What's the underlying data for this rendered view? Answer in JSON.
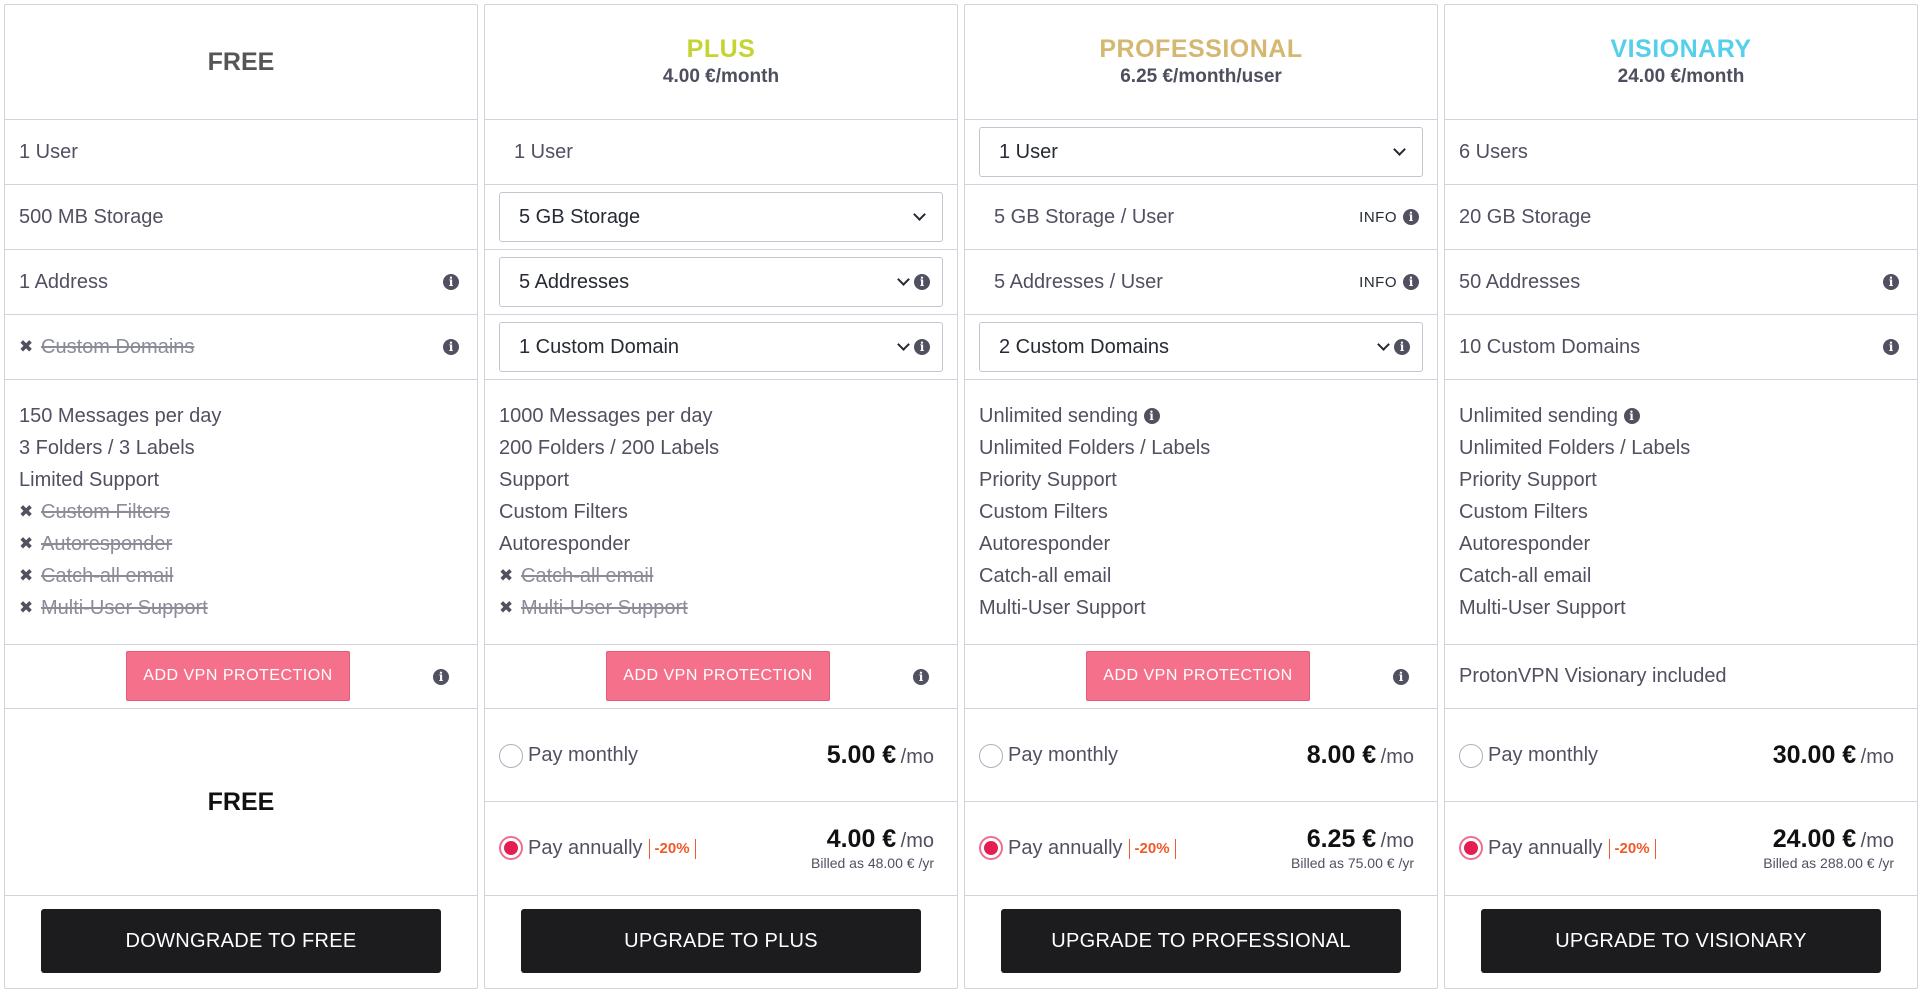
{
  "colors": {
    "plus": "#c5d433",
    "professional": "#d4b770",
    "visionary": "#55cfea",
    "vpn_button": "#f5708b",
    "cta_button": "#1c1c1f",
    "discount": "#f05a28",
    "radio_selected": "#e41e53"
  },
  "icons": {
    "info": "info-circle-icon",
    "unavailable": "x-icon",
    "dropdown": "chevron-down-icon"
  },
  "info_label": "INFO",
  "plans": {
    "free": {
      "name": "FREE",
      "users": "1 User",
      "storage": "500 MB Storage",
      "addresses": "1 Address",
      "domains": "Custom Domains",
      "features": [
        "150 Messages per day",
        "3 Folders / 3 Labels",
        "Limited Support",
        "Custom Filters",
        "Autoresponder",
        "Catch-all email",
        "Multi-User Support"
      ],
      "vpn_button": "ADD VPN PROTECTION",
      "price": "FREE",
      "cta": "DOWNGRADE TO FREE"
    },
    "plus": {
      "name": "PLUS",
      "price_line": "4.00 €/month",
      "users": "1 User",
      "storage": "5 GB Storage",
      "addresses": "5 Addresses",
      "domains": "1 Custom Domain",
      "features": [
        "1000 Messages per day",
        "200 Folders / 200 Labels",
        "Support",
        "Custom Filters",
        "Autoresponder",
        "Catch-all email",
        "Multi-User Support"
      ],
      "vpn_button": "ADD VPN PROTECTION",
      "monthly_label": "Pay monthly",
      "monthly_price": "5.00 €",
      "annual_label": "Pay annually",
      "discount": "-20%",
      "annual_price": "4.00 €",
      "per_month": "/mo",
      "billed": "Billed as 48.00 € /yr",
      "cta": "UPGRADE TO PLUS"
    },
    "professional": {
      "name": "PROFESSIONAL",
      "price_line": "6.25 €/month/user",
      "users": "1 User",
      "storage": "5 GB Storage / User",
      "addresses": "5 Addresses / User",
      "domains": "2 Custom Domains",
      "features": [
        "Unlimited sending",
        "Unlimited Folders / Labels",
        "Priority Support",
        "Custom Filters",
        "Autoresponder",
        "Catch-all email",
        "Multi-User Support"
      ],
      "vpn_button": "ADD VPN PROTECTION",
      "monthly_label": "Pay monthly",
      "monthly_price": "8.00 €",
      "annual_label": "Pay annually",
      "discount": "-20%",
      "annual_price": "6.25 €",
      "per_month": "/mo",
      "billed": "Billed as 75.00 € /yr",
      "cta": "UPGRADE TO PROFESSIONAL"
    },
    "visionary": {
      "name": "VISIONARY",
      "price_line": "24.00 €/month",
      "users": "6 Users",
      "storage": "20 GB Storage",
      "addresses": "50 Addresses",
      "domains": "10 Custom Domains",
      "features": [
        "Unlimited sending",
        "Unlimited Folders / Labels",
        "Priority Support",
        "Custom Filters",
        "Autoresponder",
        "Catch-all email",
        "Multi-User Support"
      ],
      "vpn_text": "ProtonVPN Visionary included",
      "monthly_label": "Pay monthly",
      "monthly_price": "30.00 €",
      "annual_label": "Pay annually",
      "discount": "-20%",
      "annual_price": "24.00 €",
      "per_month": "/mo",
      "billed": "Billed as 288.00 € /yr",
      "cta": "UPGRADE TO VISIONARY"
    }
  }
}
